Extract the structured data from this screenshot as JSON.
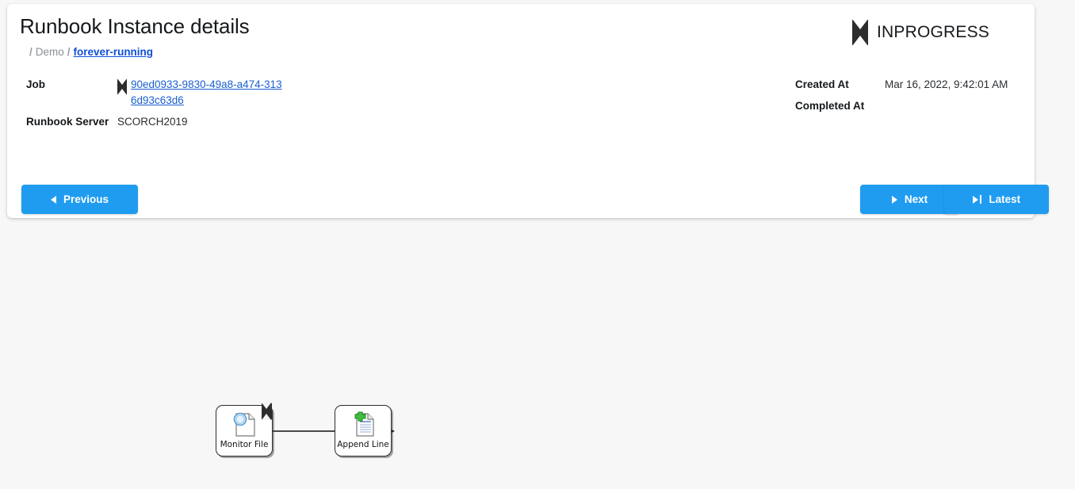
{
  "page": {
    "background_color": "#f7f7f7",
    "accent_color": "#1f9cf0",
    "link_color": "#1a5fd0"
  },
  "header": {
    "title": "Runbook Instance details",
    "breadcrumb": {
      "separator": "/",
      "items": [
        {
          "label": "Demo",
          "link": false
        },
        {
          "label": "forever-running",
          "link": true
        }
      ]
    },
    "status": {
      "icon": "hourglass-icon",
      "label": "INPROGRESS"
    }
  },
  "details": {
    "left": [
      {
        "label": "Job",
        "value": "90ed0933-9830-49a8-a474-3136d93c63d6",
        "is_link": true,
        "icon": "hourglass-icon"
      },
      {
        "label": "Runbook Server",
        "value": "SCORCH2019",
        "is_link": false
      }
    ],
    "right": [
      {
        "label": "Created At",
        "value": "Mar 16, 2022, 9:42:01 AM"
      },
      {
        "label": "Completed At",
        "value": ""
      }
    ]
  },
  "actions": {
    "previous": {
      "label": "Previous",
      "icon": "triangle-left-icon"
    },
    "next": {
      "label": "Next",
      "icon": "triangle-right-icon"
    },
    "latest": {
      "label": "Latest",
      "icon": "skip-to-end-icon"
    }
  },
  "diagram": {
    "nodes": [
      {
        "label": "Monitor File",
        "icon": "document-monitor-icon",
        "status_badge": "hourglass-icon"
      },
      {
        "label": "Append Line",
        "icon": "document-append-icon",
        "status_badge": ""
      }
    ],
    "connector": {
      "from": "Monitor File",
      "to": "Append Line",
      "arrow": "arrowhead-right"
    }
  }
}
